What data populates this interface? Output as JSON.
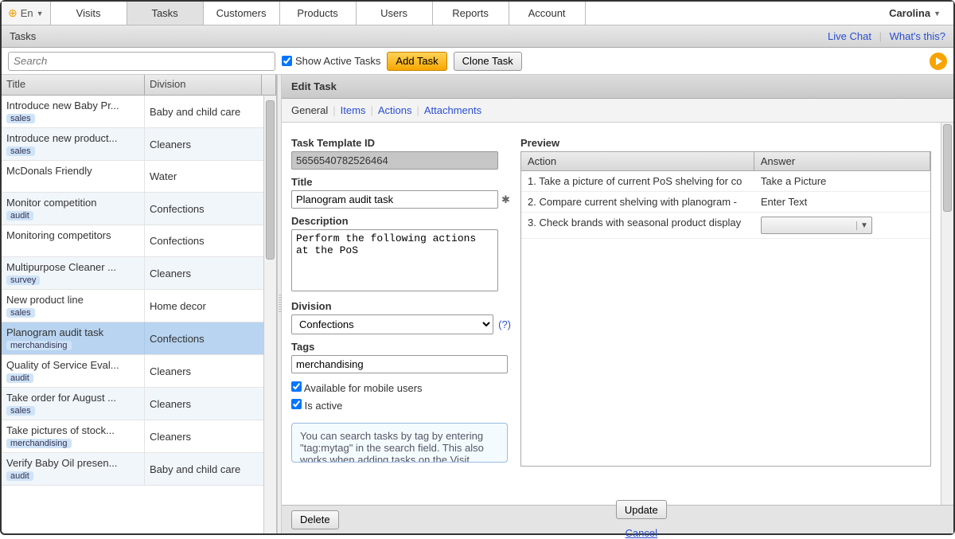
{
  "lang": "En",
  "nav": {
    "tabs": [
      "Visits",
      "Tasks",
      "Customers",
      "Products",
      "Users",
      "Reports",
      "Account"
    ],
    "active": 1
  },
  "user": "Carolina",
  "page_title": "Tasks",
  "header_links": {
    "live_chat": "Live Chat",
    "whats_this": "What's this?"
  },
  "toolbar": {
    "search_ph": "Search",
    "show_active": "Show Active Tasks",
    "add_task": "Add Task",
    "clone_task": "Clone Task"
  },
  "cols": {
    "title": "Title",
    "division": "Division"
  },
  "tasks": [
    {
      "title": "Introduce new Baby Pr...",
      "tag": "sales",
      "division": "Baby and child care"
    },
    {
      "title": "Introduce new product...",
      "tag": "sales",
      "division": "Cleaners"
    },
    {
      "title": "McDonals Friendly",
      "tag": null,
      "division": "Water"
    },
    {
      "title": "Monitor competition",
      "tag": "audit",
      "division": "Confections"
    },
    {
      "title": "Monitoring competitors",
      "tag": null,
      "division": "Confections"
    },
    {
      "title": "Multipurpose Cleaner ...",
      "tag": "survey",
      "division": "Cleaners"
    },
    {
      "title": "New product line",
      "tag": "sales",
      "division": "Home decor"
    },
    {
      "title": "Planogram audit task",
      "tag": "merchandising",
      "division": "Confections",
      "selected": true
    },
    {
      "title": "Quality of Service Eval...",
      "tag": "audit",
      "division": "Cleaners"
    },
    {
      "title": "Take order for August ...",
      "tag": "sales",
      "division": "Cleaners"
    },
    {
      "title": "Take pictures of stock...",
      "tag": "merchandising",
      "division": "Cleaners"
    },
    {
      "title": "Verify Baby Oil presen...",
      "tag": "audit",
      "division": "Baby and child care"
    }
  ],
  "edit": {
    "panel_title": "Edit Task",
    "subtabs": [
      "General",
      "Items",
      "Actions",
      "Attachments"
    ],
    "labels": {
      "template_id": "Task Template ID",
      "title": "Title",
      "description": "Description",
      "division": "Division",
      "tags": "Tags",
      "avail_mobile": "Available for mobile users",
      "is_active": "Is active"
    },
    "template_id": "5656540782526464",
    "title": "Planogram audit task",
    "description": "Perform the following actions at the PoS",
    "division": "Confections",
    "division_help": "(?)",
    "tags": "merchandising",
    "hint": "You can search tasks by tag by entering \"tag:mytag\" in the search field. This also works when adding tasks on the Visit"
  },
  "preview": {
    "label": "Preview",
    "cols": {
      "action": "Action",
      "answer": "Answer"
    },
    "rows": [
      {
        "n": "1.",
        "action": "Take a picture of current PoS shelving for co",
        "answer": "Take a Picture"
      },
      {
        "n": "2.",
        "action": "Compare current shelving with planogram -",
        "answer": "Enter Text"
      },
      {
        "n": "3.",
        "action": "Check brands with seasonal product display",
        "answer": "__select__"
      }
    ]
  },
  "footer": {
    "delete": "Delete",
    "update": "Update",
    "cancel": "Cancel"
  }
}
